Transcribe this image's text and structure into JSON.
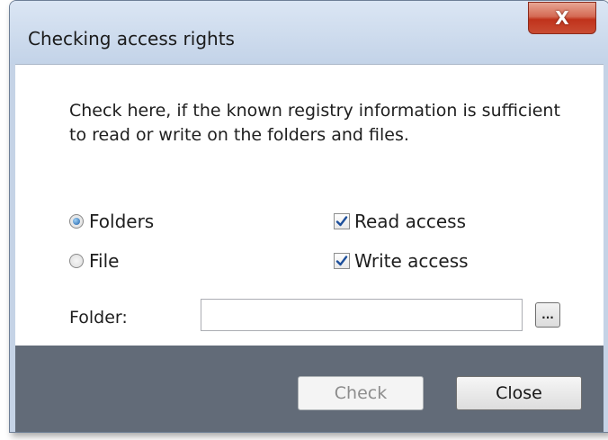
{
  "window": {
    "title": "Checking access rights",
    "close_glyph": "X"
  },
  "main": {
    "description": "Check here, if the known registry information is sufficient to read or write on the folders and files.",
    "options": {
      "radio_folders": {
        "label": "Folders",
        "selected": true
      },
      "radio_file": {
        "label": "File",
        "selected": false
      },
      "check_read": {
        "label": "Read access",
        "checked": true
      },
      "check_write": {
        "label": "Write access",
        "checked": true
      }
    },
    "folder": {
      "label": "Folder:",
      "value": "",
      "browse_label": "..."
    }
  },
  "footer": {
    "check_label": "Check",
    "check_enabled": false,
    "close_label": "Close"
  },
  "colors": {
    "accent": "#1d5fa8",
    "footer_bg": "#626b78",
    "close_red": "#c0321b"
  }
}
